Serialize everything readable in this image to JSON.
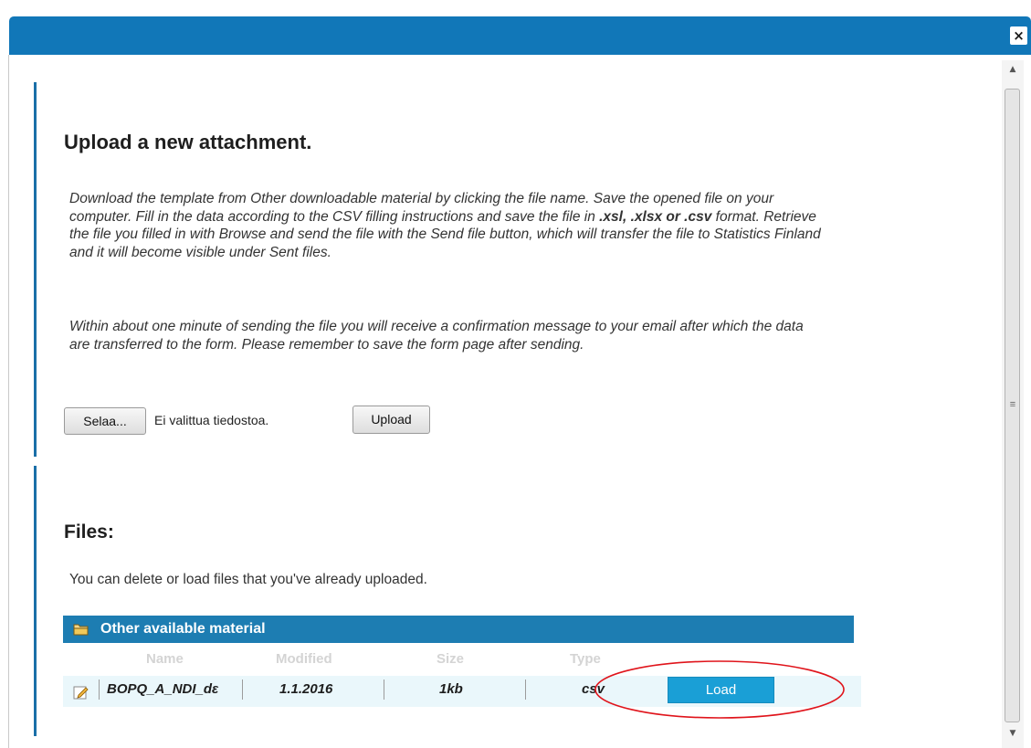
{
  "window": {
    "close_label": "×"
  },
  "upload": {
    "title": "Upload a new attachment.",
    "paragraph1": [
      {
        "text": "Download the template from Other downloadable material by clicking the file name. Save the opened file on your computer. Fill in the data according to the CSV filling instructions and save the file in ",
        "bold": false
      },
      {
        "text": ".xsl, .xlsx or .csv",
        "bold": true
      },
      {
        "text": " format. Retrieve the file you filled in with Browse and send the file with the Send file button, which will transfer the file to Statistics Finland and it will become visible under Sent files.",
        "bold": false
      }
    ],
    "paragraph2": "Within about one minute of sending the file you will receive a confirmation message to your email after which the data are transferred to the form. Please remember to save the form page after sending.",
    "browse_label": "Selaa...",
    "no_file_label": "Ei valittua tiedostoa.",
    "upload_label": "Upload"
  },
  "files": {
    "title": "Files:",
    "description": "You can delete or load files that you've already uploaded.",
    "table_title": "Other available material",
    "columns": [
      "Name",
      "Modified",
      "Size",
      "Type"
    ],
    "rows": [
      {
        "name": "BOPQ_A_NDI_dε",
        "modified": "1.1.2016",
        "size": "1kb",
        "type": "csv",
        "action": "Load"
      }
    ]
  },
  "colors": {
    "header_bar": "#1177b8",
    "table_header": "#1d7db2",
    "load_button": "#1a9fd6",
    "row_background": "#eaf7fb",
    "annotation": "#e0141b"
  },
  "icons": [
    "close-icon",
    "scroll-up-icon",
    "scroll-down-icon",
    "folder-icon",
    "edit-icon"
  ]
}
